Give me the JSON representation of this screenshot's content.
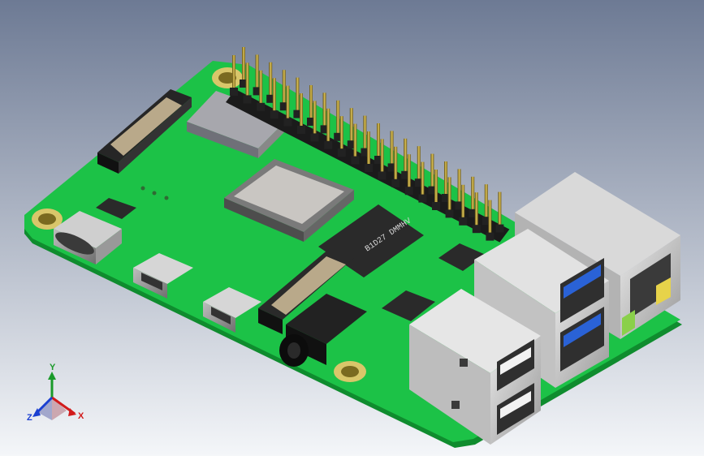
{
  "viewport": {
    "background_top": "#6d7a94",
    "background_bottom": "#f4f6f9"
  },
  "board": {
    "pcb_color": "#1cc247",
    "pcb_edge_color": "#0f8c2e",
    "hole_pad_color": "#d9c66a"
  },
  "chips": {
    "wireless_marking": "B1D27 DMMHV"
  },
  "triad": {
    "x_label": "X",
    "y_label": "Y",
    "z_label": "Z",
    "x_color": "#d11b1b",
    "y_color": "#1a9a2a",
    "z_color": "#1a3fd1"
  }
}
